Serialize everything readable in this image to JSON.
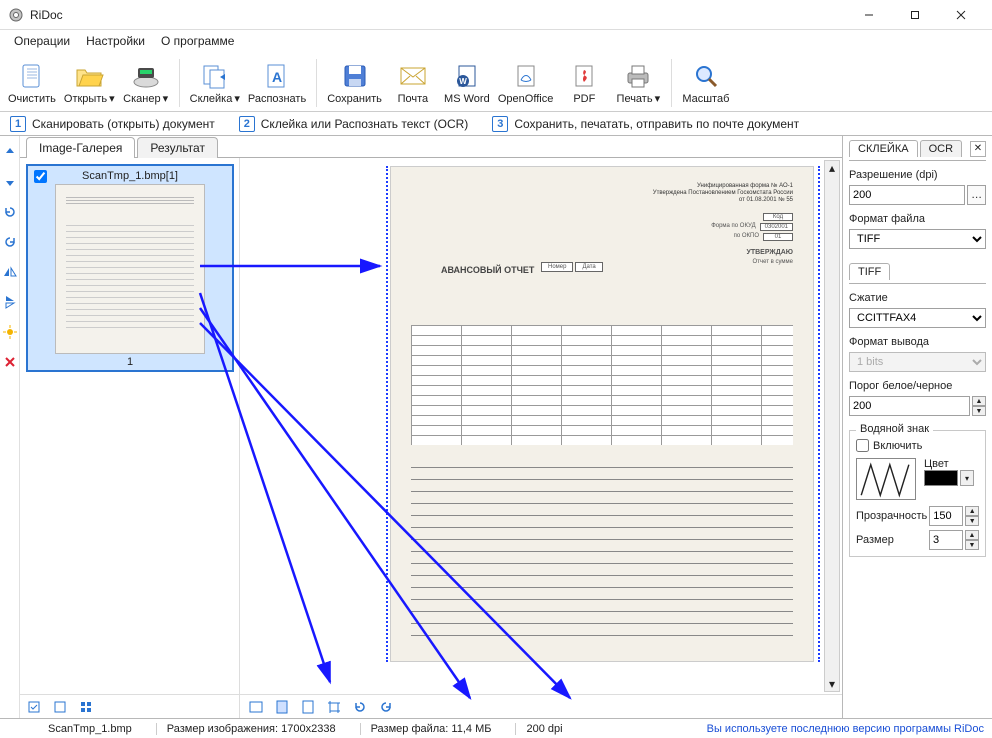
{
  "window": {
    "title": "RiDoc"
  },
  "menu": {
    "operations": "Операции",
    "settings": "Настройки",
    "about": "О программе"
  },
  "toolbar": {
    "clear": "Очистить",
    "open": "Открыть",
    "scanner": "Сканер",
    "stitch": "Склейка",
    "recognize": "Распознать",
    "save": "Сохранить",
    "mail": "Почта",
    "msword": "MS Word",
    "openoffice": "OpenOffice",
    "pdf": "PDF",
    "print": "Печать",
    "zoom": "Масштаб"
  },
  "steps": {
    "s1": "Сканировать (открыть) документ",
    "s2": "Склейка или Распознать текст (OCR)",
    "s3": "Сохранить, печатать, отправить по почте документ"
  },
  "tabs": {
    "gallery": "Image-Галерея",
    "result": "Результат"
  },
  "thumb": {
    "filename": "ScanTmp_1.bmp[1]",
    "page_num": "1"
  },
  "status": {
    "file": "ScanTmp_1.bmp",
    "imgsize_label": "Размер изображения:",
    "imgsize_value": "1700x2338",
    "filesize_label": "Размер файла:",
    "filesize_value": "11,4 МБ",
    "dpi": "200 dpi",
    "link": "Вы используете последнюю версию программы RiDoc"
  },
  "panel": {
    "tab_stitch": "СКЛЕЙКА",
    "tab_ocr": "OCR",
    "resolution_label": "Разрешение (dpi)",
    "resolution_value": "200",
    "format_label": "Формат файла",
    "format_value": "TIFF",
    "tiff_tab": "TIFF",
    "compression_label": "Сжатие",
    "compression_value": "CCITTFAX4",
    "output_label": "Формат вывода",
    "output_value": "1 bits",
    "threshold_label": "Порог белое/черное",
    "threshold_value": "200",
    "watermark_group": "Водяной знак",
    "watermark_enable": "Включить",
    "color_label": "Цвет",
    "opacity_label": "Прозрачность",
    "opacity_value": "150",
    "size_label": "Размер",
    "size_value": "3"
  },
  "docpreview": {
    "header_line1": "Унифицированная форма № АО-1",
    "header_line2": "Утверждена Постановлением Госкомстата России",
    "header_line3": "от 01.08.2001 № 55",
    "code_label": "Код",
    "okud_label": "Форма по ОКУД",
    "okud_value": "0302001",
    "okpo_label": "по ОКПО",
    "okpo_value": "01",
    "title": "АВАНСОВЫЙ ОТЧЕТ",
    "num_label": "Номер",
    "date_label": "Дата",
    "approve": "УТВЕРЖДАЮ",
    "report_sum": "Отчет в сумме"
  }
}
